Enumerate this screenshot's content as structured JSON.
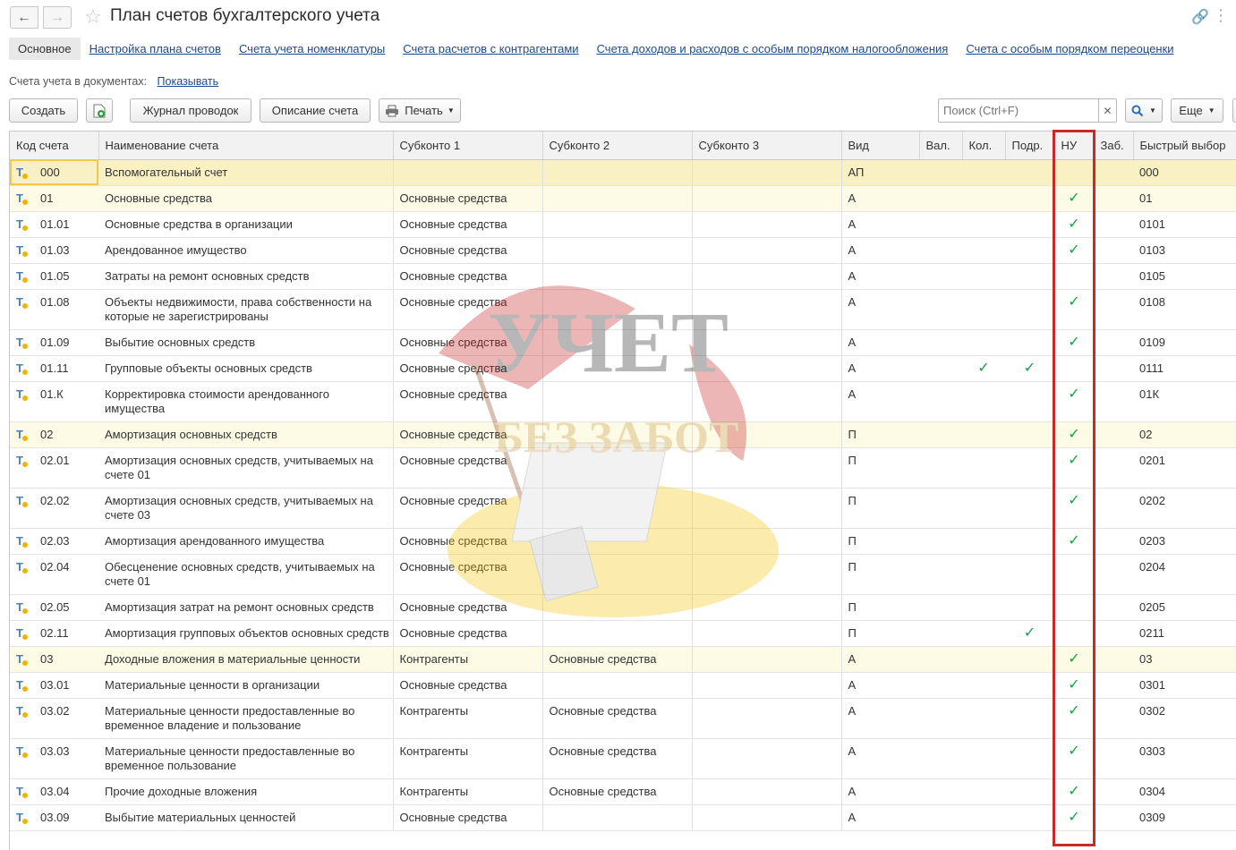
{
  "window": {
    "title": "План счетов бухгалтерского учета"
  },
  "tabs": [
    {
      "label": "Основное",
      "active": true
    },
    {
      "label": "Настройка плана счетов"
    },
    {
      "label": "Счета учета номенклатуры"
    },
    {
      "label": "Счета расчетов с контрагентами"
    },
    {
      "label": "Счета доходов и расходов с особым порядком налогообложения"
    },
    {
      "label": "Счета с особым порядком переоценки"
    }
  ],
  "doc_accounts": {
    "label": "Счета учета в документах:",
    "link": "Показывать"
  },
  "toolbar": {
    "create": "Создать",
    "journal": "Журнал проводок",
    "description": "Описание счета",
    "print": "Печать",
    "search_placeholder": "Поиск (Ctrl+F)",
    "more": "Еще"
  },
  "columns": [
    "Код счета",
    "Наименование счета",
    "Субконто 1",
    "Субконто 2",
    "Субконто 3",
    "Вид",
    "Вал.",
    "Кол.",
    "Подр.",
    "НУ",
    "Заб.",
    "Быстрый выбор"
  ],
  "check_mark": "✓",
  "rows": [
    {
      "code": "000",
      "name": "Вспомогательный счет",
      "s1": "",
      "s2": "",
      "s3": "",
      "kind": "АП",
      "val": false,
      "kol": false,
      "podr": false,
      "nu": false,
      "quick": "000",
      "style": "sel"
    },
    {
      "code": "01",
      "name": "Основные средства",
      "s1": "Основные средства",
      "s2": "",
      "s3": "",
      "kind": "А",
      "val": false,
      "kol": false,
      "podr": false,
      "nu": true,
      "quick": "01",
      "style": "group"
    },
    {
      "code": "01.01",
      "name": "Основные средства в организации",
      "s1": "Основные средства",
      "s2": "",
      "s3": "",
      "kind": "А",
      "val": false,
      "kol": false,
      "podr": false,
      "nu": true,
      "quick": "0101",
      "style": ""
    },
    {
      "code": "01.03",
      "name": "Арендованное имущество",
      "s1": "Основные средства",
      "s2": "",
      "s3": "",
      "kind": "А",
      "val": false,
      "kol": false,
      "podr": false,
      "nu": true,
      "quick": "0103",
      "style": ""
    },
    {
      "code": "01.05",
      "name": "Затраты на ремонт основных средств",
      "s1": "Основные средства",
      "s2": "",
      "s3": "",
      "kind": "А",
      "val": false,
      "kol": false,
      "podr": false,
      "nu": false,
      "quick": "0105",
      "style": ""
    },
    {
      "code": "01.08",
      "name": "Объекты недвижимости, права собственности на которые не зарегистрированы",
      "s1": "Основные средства",
      "s2": "",
      "s3": "",
      "kind": "А",
      "val": false,
      "kol": false,
      "podr": false,
      "nu": true,
      "quick": "0108",
      "style": ""
    },
    {
      "code": "01.09",
      "name": "Выбытие основных средств",
      "s1": "Основные средства",
      "s2": "",
      "s3": "",
      "kind": "А",
      "val": false,
      "kol": false,
      "podr": false,
      "nu": true,
      "quick": "0109",
      "style": ""
    },
    {
      "code": "01.11",
      "name": "Групповые объекты основных средств",
      "s1": "Основные средства",
      "s2": "",
      "s3": "",
      "kind": "А",
      "val": false,
      "kol": true,
      "podr": true,
      "nu": false,
      "quick": "0111",
      "style": ""
    },
    {
      "code": "01.К",
      "name": "Корректировка стоимости арендованного имущества",
      "s1": "Основные средства",
      "s2": "",
      "s3": "",
      "kind": "А",
      "val": false,
      "kol": false,
      "podr": false,
      "nu": true,
      "quick": "01К",
      "style": ""
    },
    {
      "code": "02",
      "name": "Амортизация основных средств",
      "s1": "Основные средства",
      "s2": "",
      "s3": "",
      "kind": "П",
      "val": false,
      "kol": false,
      "podr": false,
      "nu": true,
      "quick": "02",
      "style": "group"
    },
    {
      "code": "02.01",
      "name": "Амортизация основных средств, учитываемых на счете 01",
      "s1": "Основные средства",
      "s2": "",
      "s3": "",
      "kind": "П",
      "val": false,
      "kol": false,
      "podr": false,
      "nu": true,
      "quick": "0201",
      "style": ""
    },
    {
      "code": "02.02",
      "name": "Амортизация основных средств, учитываемых на счете 03",
      "s1": "Основные средства",
      "s2": "",
      "s3": "",
      "kind": "П",
      "val": false,
      "kol": false,
      "podr": false,
      "nu": true,
      "quick": "0202",
      "style": ""
    },
    {
      "code": "02.03",
      "name": "Амортизация арендованного имущества",
      "s1": "Основные средства",
      "s2": "",
      "s3": "",
      "kind": "П",
      "val": false,
      "kol": false,
      "podr": false,
      "nu": true,
      "quick": "0203",
      "style": ""
    },
    {
      "code": "02.04",
      "name": "Обесценение основных средств, учитываемых на счете 01",
      "s1": "Основные средства",
      "s2": "",
      "s3": "",
      "kind": "П",
      "val": false,
      "kol": false,
      "podr": false,
      "nu": false,
      "quick": "0204",
      "style": ""
    },
    {
      "code": "02.05",
      "name": "Амортизация затрат на ремонт основных средств",
      "s1": "Основные средства",
      "s2": "",
      "s3": "",
      "kind": "П",
      "val": false,
      "kol": false,
      "podr": false,
      "nu": false,
      "quick": "0205",
      "style": ""
    },
    {
      "code": "02.11",
      "name": "Амортизация групповых объектов основных средств",
      "s1": "Основные средства",
      "s2": "",
      "s3": "",
      "kind": "П",
      "val": false,
      "kol": false,
      "podr": true,
      "nu": false,
      "quick": "0211",
      "style": ""
    },
    {
      "code": "03",
      "name": "Доходные вложения в материальные ценности",
      "s1": "Контрагенты",
      "s2": "Основные средства",
      "s3": "",
      "kind": "А",
      "val": false,
      "kol": false,
      "podr": false,
      "nu": true,
      "quick": "03",
      "style": "group"
    },
    {
      "code": "03.01",
      "name": "Материальные ценности в организации",
      "s1": "Основные средства",
      "s2": "",
      "s3": "",
      "kind": "А",
      "val": false,
      "kol": false,
      "podr": false,
      "nu": true,
      "quick": "0301",
      "style": ""
    },
    {
      "code": "03.02",
      "name": "Материальные ценности предоставленные во временное владение и пользование",
      "s1": "Контрагенты",
      "s2": "Основные средства",
      "s3": "",
      "kind": "А",
      "val": false,
      "kol": false,
      "podr": false,
      "nu": true,
      "quick": "0302",
      "style": ""
    },
    {
      "code": "03.03",
      "name": "Материальные ценности предоставленные во временное пользование",
      "s1": "Контрагенты",
      "s2": "Основные средства",
      "s3": "",
      "kind": "А",
      "val": false,
      "kol": false,
      "podr": false,
      "nu": true,
      "quick": "0303",
      "style": ""
    },
    {
      "code": "03.04",
      "name": "Прочие доходные вложения",
      "s1": "Контрагенты",
      "s2": "Основные средства",
      "s3": "",
      "kind": "А",
      "val": false,
      "kol": false,
      "podr": false,
      "nu": true,
      "quick": "0304",
      "style": ""
    },
    {
      "code": "03.09",
      "name": "Выбытие материальных ценностей",
      "s1": "Основные средства",
      "s2": "",
      "s3": "",
      "kind": "А",
      "val": false,
      "kol": false,
      "podr": false,
      "nu": true,
      "quick": "0309",
      "style": ""
    }
  ],
  "watermark": {
    "line1": "УЧЕТ",
    "line2": "БЕЗ ЗАБОТ"
  },
  "colors": {
    "link": "#1f4a8c",
    "check": "#17a143",
    "highlight": "#c62b2b",
    "selected_row": "#f9f0c3",
    "group_row": "#fdfbe6"
  }
}
